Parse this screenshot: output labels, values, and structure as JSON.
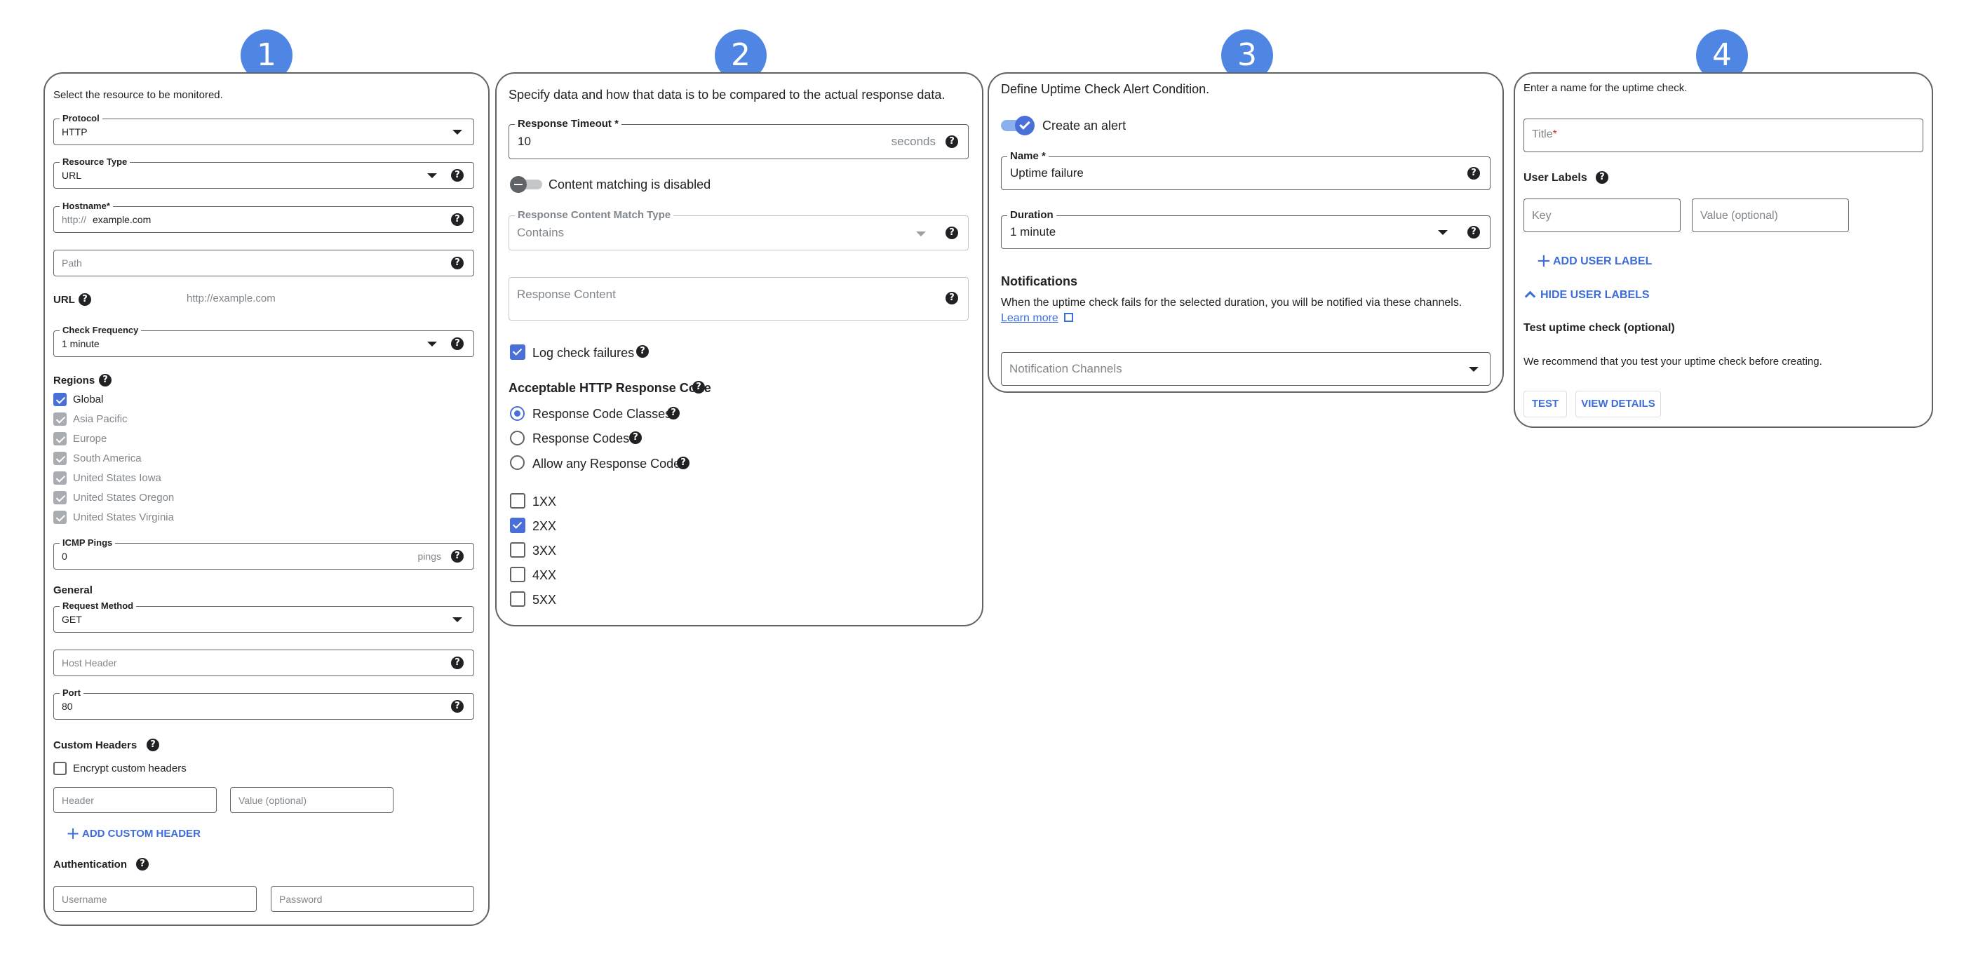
{
  "badges": [
    "1",
    "2",
    "3",
    "4"
  ],
  "panel1": {
    "intro": "Select the resource to be monitored.",
    "protocol": {
      "label": "Protocol",
      "value": "HTTP"
    },
    "resource_type": {
      "label": "Resource Type",
      "value": "URL"
    },
    "hostname": {
      "label": "Hostname*",
      "prefix": "http://",
      "value": "example.com"
    },
    "path": {
      "placeholder": "Path"
    },
    "url": {
      "label": "URL",
      "value": "http://example.com"
    },
    "check_frequency": {
      "label": "Check Frequency",
      "value": "1 minute"
    },
    "regions": {
      "label": "Regions",
      "items": [
        {
          "label": "Global",
          "state": "checked"
        },
        {
          "label": "Asia Pacific",
          "state": "disabled"
        },
        {
          "label": "Europe",
          "state": "disabled"
        },
        {
          "label": "South America",
          "state": "disabled"
        },
        {
          "label": "United States Iowa",
          "state": "disabled"
        },
        {
          "label": "United States Oregon",
          "state": "disabled"
        },
        {
          "label": "United States Virginia",
          "state": "disabled"
        }
      ]
    },
    "icmp": {
      "label": "ICMP Pings",
      "value": "0",
      "suffix": "pings"
    },
    "general": "General",
    "request_method": {
      "label": "Request Method",
      "value": "GET"
    },
    "host_header": {
      "placeholder": "Host Header"
    },
    "port": {
      "label": "Port",
      "value": "80"
    },
    "custom_headers": "Custom Headers",
    "encrypt": "Encrypt custom headers",
    "header_placeholder": "Header",
    "header_value_placeholder": "Value (optional)",
    "add_custom_header": "ADD CUSTOM HEADER",
    "authentication": "Authentication",
    "username_placeholder": "Username",
    "password_placeholder": "Password"
  },
  "panel2": {
    "intro": "Specify data and how that data is to be compared to the actual response data.",
    "timeout": {
      "label": "Response Timeout *",
      "value": "10",
      "suffix": "seconds"
    },
    "content_matching": "Content matching is disabled",
    "match_type": {
      "label": "Response Content Match Type",
      "value": "Contains"
    },
    "response_content": {
      "placeholder": "Response Content"
    },
    "log_failures": "Log check failures",
    "acceptable_codes": "Acceptable HTTP Response Code",
    "radios": [
      {
        "label": "Response Code Classes",
        "selected": true
      },
      {
        "label": "Response Codes",
        "selected": false
      },
      {
        "label": "Allow any Response Code",
        "selected": false
      }
    ],
    "code_classes": [
      {
        "label": "1XX",
        "checked": false
      },
      {
        "label": "2XX",
        "checked": true
      },
      {
        "label": "3XX",
        "checked": false
      },
      {
        "label": "4XX",
        "checked": false
      },
      {
        "label": "5XX",
        "checked": false
      }
    ]
  },
  "panel3": {
    "intro": "Define Uptime Check Alert Condition.",
    "create_alert": "Create an alert",
    "name": {
      "label": "Name *",
      "value": "Uptime failure"
    },
    "duration": {
      "label": "Duration",
      "value": "1 minute"
    },
    "notifications_title": "Notifications",
    "notifications_desc": "When the uptime check fails for the selected duration, you will be notified via these channels.",
    "learn_more": "Learn more",
    "channels": {
      "placeholder": "Notification Channels"
    }
  },
  "panel4": {
    "intro": "Enter a name for the uptime check.",
    "title": {
      "placeholder": "Title",
      "required_mark": "*"
    },
    "user_labels": "User Labels",
    "key_placeholder": "Key",
    "value_placeholder": "Value (optional)",
    "add_user_label": "ADD USER LABEL",
    "hide_user_labels": "HIDE USER LABELS",
    "test_title": "Test uptime check (optional)",
    "test_desc": "We recommend that you test your uptime check before creating.",
    "test_button": "TEST",
    "view_details_button": "VIEW DETAILS"
  },
  "colors": {
    "accent": "#4f86e4",
    "link": "#3d6dd8",
    "border": "#5f6368"
  }
}
